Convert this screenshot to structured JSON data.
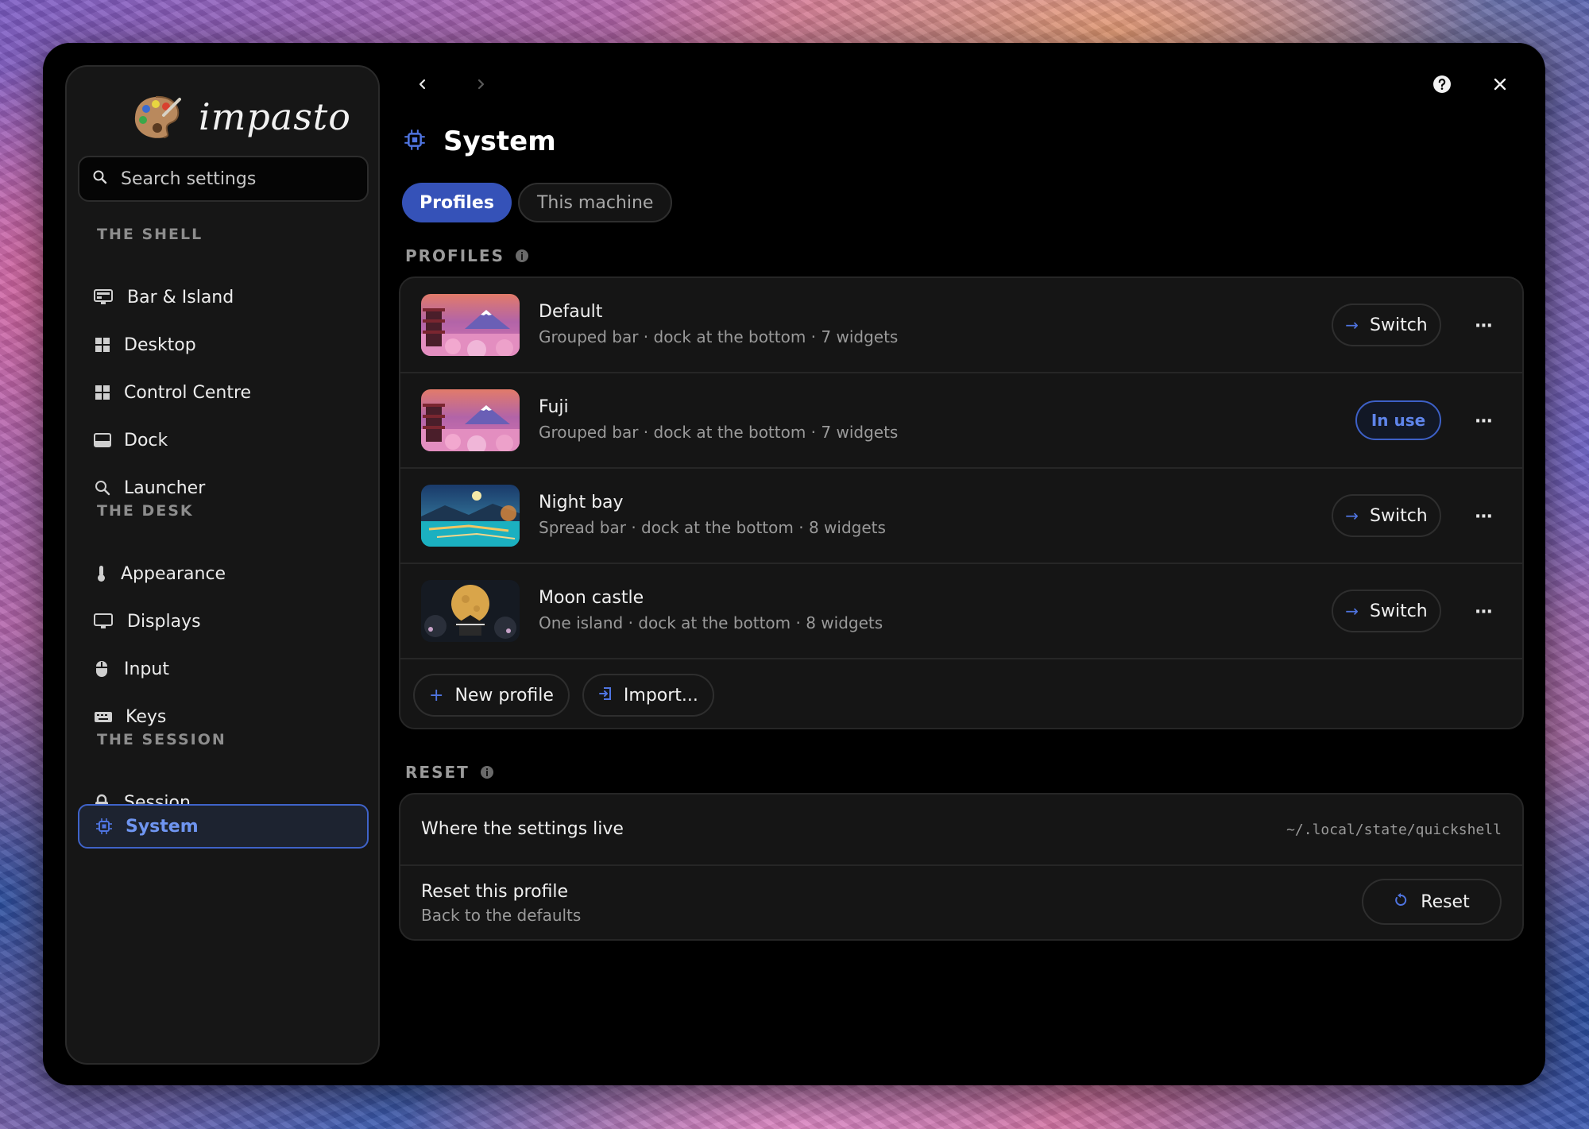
{
  "app": {
    "logo_text": "impasto"
  },
  "search": {
    "placeholder": "Search settings"
  },
  "sidebar": {
    "sections": [
      {
        "title": "THE SHELL"
      },
      {
        "title": "THE DESK"
      },
      {
        "title": "THE SESSION"
      }
    ],
    "items": [
      {
        "label": "Bar & Island",
        "icon": "monitor-bar-icon"
      },
      {
        "label": "Desktop",
        "icon": "grid-icon"
      },
      {
        "label": "Control Centre",
        "icon": "grid-icon"
      },
      {
        "label": "Dock",
        "icon": "dock-icon"
      },
      {
        "label": "Launcher",
        "icon": "search-icon"
      },
      {
        "label": "Appearance",
        "icon": "thermometer-icon"
      },
      {
        "label": "Displays",
        "icon": "monitor-icon"
      },
      {
        "label": "Input",
        "icon": "mouse-icon"
      },
      {
        "label": "Keys",
        "icon": "keyboard-icon"
      },
      {
        "label": "Session",
        "icon": "lock-icon"
      },
      {
        "label": "System",
        "icon": "chip-icon",
        "active": true
      }
    ]
  },
  "page": {
    "title": "System",
    "tabs": [
      {
        "label": "Profiles",
        "active": true
      },
      {
        "label": "This machine",
        "active": false
      }
    ]
  },
  "profiles": {
    "heading": "PROFILES",
    "items": [
      {
        "name": "Default",
        "description": "Grouped bar · dock at the bottom · 7 widgets",
        "action": "Switch"
      },
      {
        "name": "Fuji",
        "description": "Grouped bar · dock at the bottom · 7 widgets",
        "action": "In use"
      },
      {
        "name": "Night bay",
        "description": "Spread bar · dock at the bottom · 8 widgets",
        "action": "Switch"
      },
      {
        "name": "Moon castle",
        "description": "One island · dock at the bottom · 8 widgets",
        "action": "Switch"
      }
    ],
    "new_profile_label": "New profile",
    "import_label": "Import..."
  },
  "reset": {
    "heading": "RESET",
    "settings_location_label": "Where the settings live",
    "settings_location_value": "~/.local/state/quickshell",
    "reset_profile_label": "Reset this profile",
    "reset_profile_sub": "Back to the defaults",
    "reset_button_label": "Reset"
  },
  "colors": {
    "accent": "#3552b8",
    "accent_text": "#6f95f0",
    "window_bg": "#000000",
    "card_bg": "#151515"
  }
}
